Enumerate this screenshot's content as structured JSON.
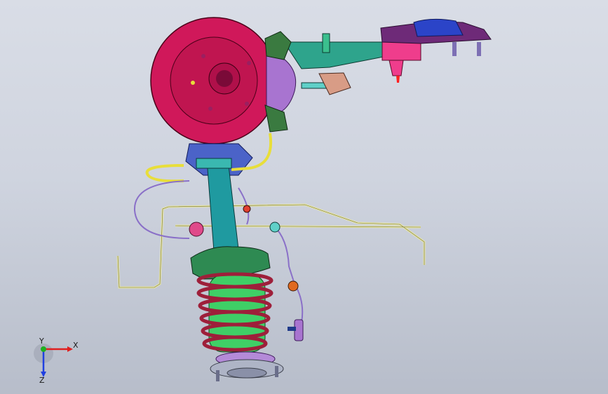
{
  "viewport": {
    "background_top": "#d9dde6",
    "background_bottom": "#b7bdca"
  },
  "triad": {
    "x_label": "X",
    "y_label": "Y",
    "z_label": "Z",
    "x_color": "#e02020",
    "y_color": "#20b020",
    "z_color": "#2040e0"
  },
  "parts": {
    "brake_disc": "brake-disc",
    "hub": "wheel-hub",
    "caliper": "brake-caliper",
    "control_arm": "control-arm",
    "strut": "strut-damper",
    "spring": "coil-spring",
    "mount": "strut-mount",
    "brake_line": "brake-line",
    "sensor_wire": "abs-sensor-wire",
    "stabilizer_link": "stabilizer-rod"
  },
  "colors": {
    "disc": "#d0185a",
    "caliper": "#a874d0",
    "arm": "#2ea48c",
    "strut": "#1f9aa0",
    "spring": "#9e1f3a",
    "spring_core": "#3fcf66",
    "line_yellow": "#e8de3a",
    "wire": "#8a70c8",
    "pink_bushing": "#ef3d8c",
    "blue_mount": "#2b44c8"
  }
}
